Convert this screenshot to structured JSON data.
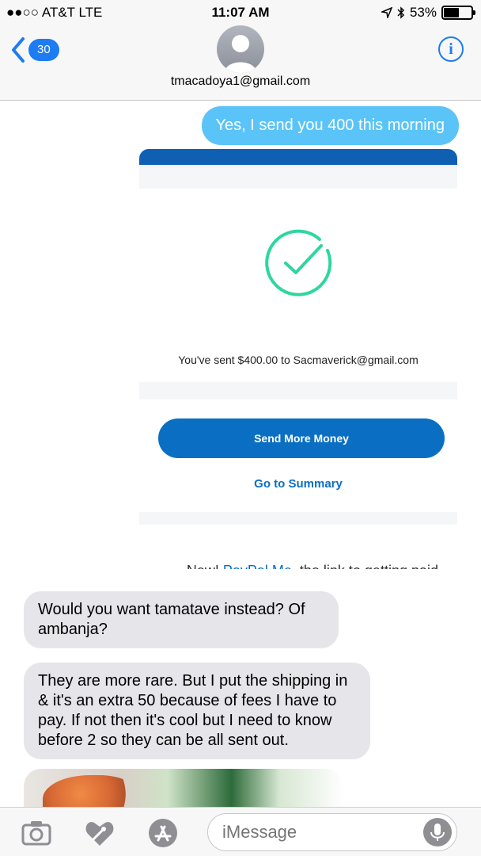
{
  "status_bar": {
    "carrier": "●●○○ AT&T  LTE",
    "time": "11:07 AM",
    "battery_pct": "53%",
    "battery_level": 0.53
  },
  "header": {
    "back_count": "30",
    "contact": "tmacadoya1@gmail.com",
    "info_icon": "info-icon"
  },
  "messages": {
    "outgoing_1": "Yes, I send you 400 this morning",
    "incoming_1": "Would you want tamatave instead? Of ambanja?",
    "incoming_2": "They are more rare. But I put the shipping in & it's an extra 50 because of fees I have to pay. If not then it's cool but I need to know before 2 so they can be all sent out."
  },
  "paypal_card": {
    "confirmation": "You've sent $400.00 to Sacmaverick@gmail.com",
    "send_more": "Send More Money",
    "summary": "Go to Summary",
    "promo_prefix": "New! ",
    "promo_link": "PayPal.Me",
    "promo_suffix": ", the link to getting paid",
    "accent_color": "#0a6fc2",
    "check_color": "#2ed6a0"
  },
  "composer": {
    "placeholder": "iMessage"
  },
  "icons": [
    "camera-icon",
    "digital-touch-icon",
    "app-store-icon",
    "microphone-icon"
  ]
}
